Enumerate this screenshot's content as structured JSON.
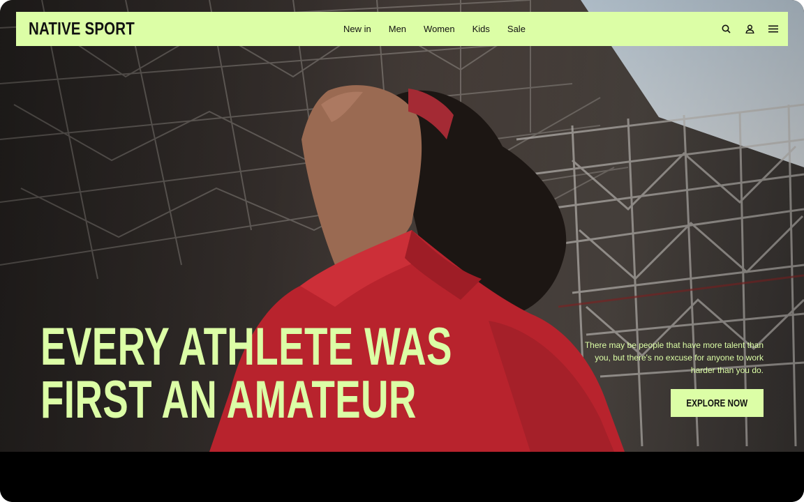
{
  "brand": {
    "logo_text": "NATIVE SPORT",
    "accent_color": "#dcfea6"
  },
  "nav": {
    "links": [
      "New in",
      "Men",
      "Women",
      "Kids",
      "Sale"
    ],
    "icons": [
      "search-icon",
      "user-icon",
      "menu-icon"
    ]
  },
  "hero": {
    "headline_line1": "EVERY ATHLETE WAS",
    "headline_line2": "FIRST AN AMATEUR",
    "tagline": "There may be people that have more talent than you, but there's no excuse for anyone to work harder than you do.",
    "cta_label": "EXPLORE NOW",
    "image_subject": "athlete in red shirt and headband looking up beneath stadium steel truss"
  }
}
